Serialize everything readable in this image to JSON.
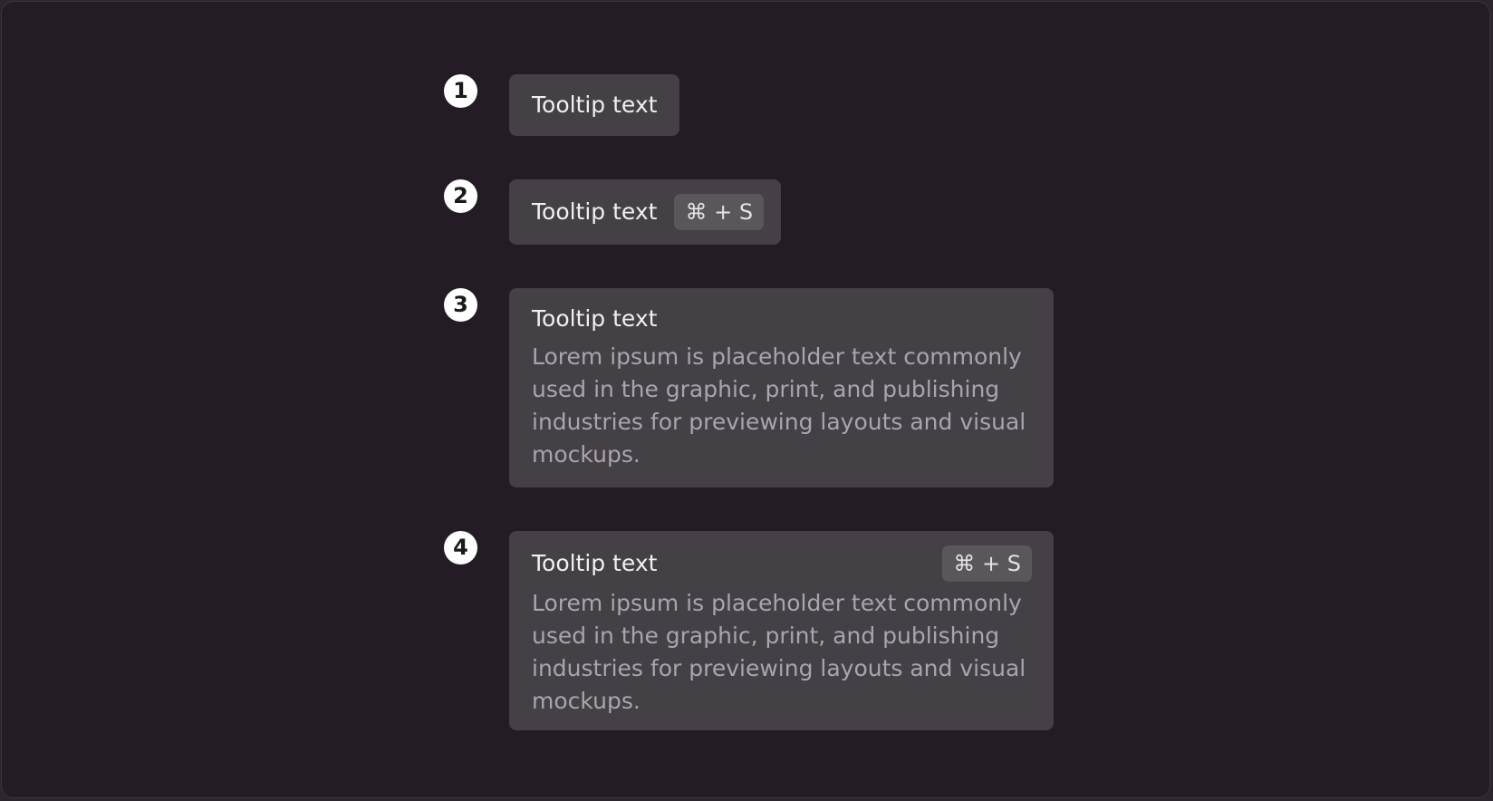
{
  "variants": [
    {
      "marker": "1",
      "title": "Tooltip text"
    },
    {
      "marker": "2",
      "title": "Tooltip text",
      "shortcut": "⌘ + S"
    },
    {
      "marker": "3",
      "title": "Tooltip text",
      "body": "Lorem ipsum is placeholder text commonly used in the graphic, print, and publishing industries for previewing layouts and visual mockups."
    },
    {
      "marker": "4",
      "title": "Tooltip text",
      "shortcut": "⌘ + S",
      "body": "Lorem ipsum is placeholder text commonly used in the graphic, print, and publishing industries for previewing layouts and visual mockups."
    }
  ],
  "colors": {
    "background": "#231c24",
    "tooltip_surface": "#444045",
    "shortcut_chip": "#5a565b",
    "title_text": "#f1eff2",
    "body_text": "#aaa5ac",
    "marker": "#ffffff"
  }
}
